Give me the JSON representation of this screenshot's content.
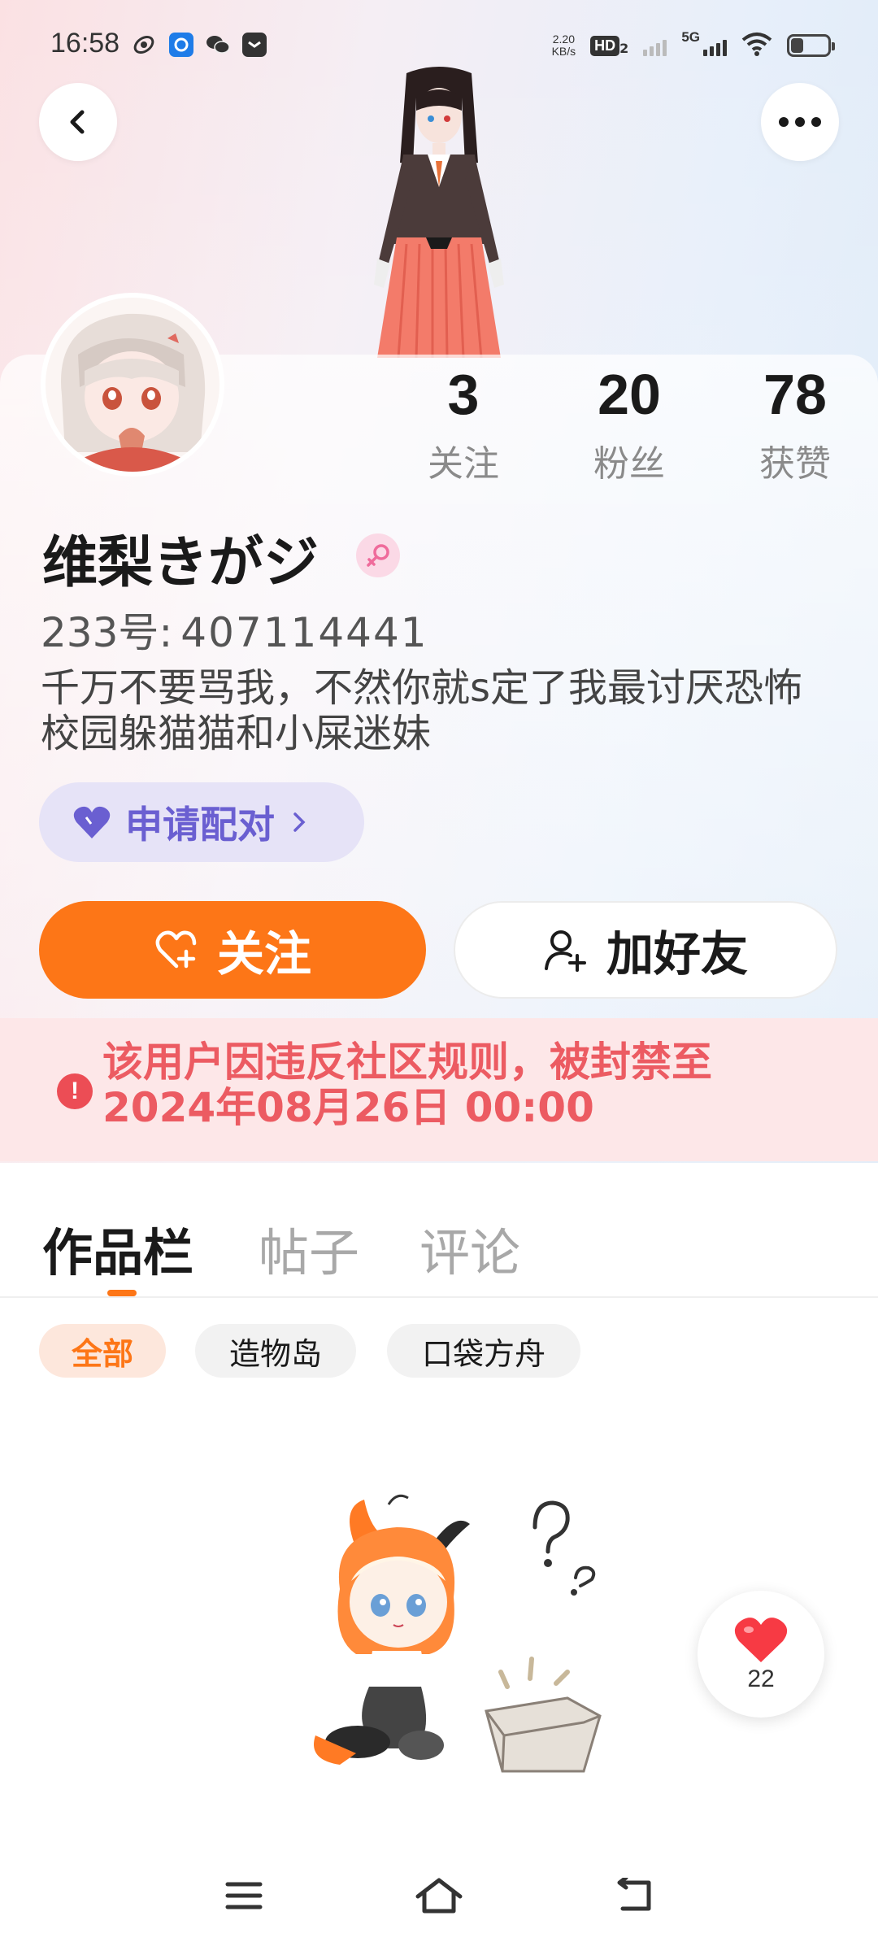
{
  "status_bar": {
    "time": "16:58",
    "net_speed_value": "2.20",
    "net_speed_unit": "KB/s",
    "hd_badge": "HD",
    "hd_sub": "2",
    "network_type": "5G",
    "battery_level": 0.35
  },
  "profile": {
    "stats": [
      {
        "value": "3",
        "label": "关注"
      },
      {
        "value": "20",
        "label": "粉丝"
      },
      {
        "value": "78",
        "label": "获赞"
      }
    ],
    "username": "维梨きがジ",
    "uid_label": "233号:",
    "uid_value": "407114441",
    "bio": "千万不要骂我，不然你就s定了我最讨厌恐怖校园躲猫猫和小屎迷妹",
    "pair_button": "申请配对",
    "follow_button": "关注",
    "add_friend_button": "加好友",
    "ban_notice": "该用户因违反社区规则，被封禁至2024年08月26日 00:00"
  },
  "tabs": [
    {
      "label": "作品栏",
      "active": true
    },
    {
      "label": "帖子",
      "active": false
    },
    {
      "label": "评论",
      "active": false
    }
  ],
  "filters": [
    {
      "label": "全部",
      "active": true
    },
    {
      "label": "造物岛",
      "active": false
    },
    {
      "label": "口袋方舟",
      "active": false
    }
  ],
  "like_fab": {
    "count": "22"
  },
  "colors": {
    "accent": "#fd7617",
    "pair_purple": "#6a5fd1",
    "ban_red": "#ec5b62",
    "ban_bg": "#fde7e8"
  }
}
